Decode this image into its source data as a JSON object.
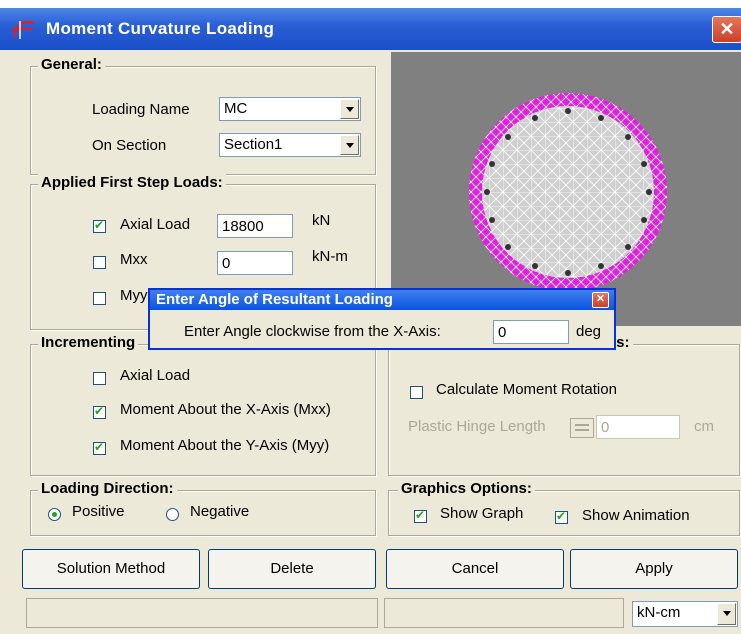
{
  "window": {
    "title": "Moment Curvature Loading",
    "close_glyph": "✕",
    "app_icon": "curvature-app-icon"
  },
  "general": {
    "title": "General:",
    "loading_name_label": "Loading Name",
    "loading_name_value": "MC",
    "on_section_label": "On Section",
    "on_section_value": "Section1"
  },
  "first_step": {
    "title": "Applied First Step Loads:",
    "axial_label": "Axial Load",
    "axial_checked": true,
    "axial_value": "18800",
    "axial_unit": "kN",
    "mxx_label": "Mxx",
    "mxx_checked": false,
    "mxx_value": "0",
    "mxx_unit": "kN-m",
    "myy_label": "Myy",
    "myy_checked": false
  },
  "incrementing": {
    "title": "Incrementing",
    "axial_label": "Axial Load",
    "axial_checked": false,
    "mxx_label": "Moment About the X-Axis (Mxx)",
    "mxx_checked": true,
    "myy_label": "Moment About the Y-Axis (Myy)",
    "myy_checked": true
  },
  "options": {
    "title_fragment": "ns:",
    "moment_rotation_label": "Calculate Moment Rotation",
    "moment_rotation_checked": false,
    "hinge_label": "Plastic Hinge Length",
    "hinge_value": "0",
    "hinge_unit": "cm"
  },
  "direction": {
    "title": "Loading Direction:",
    "positive_label": "Positive",
    "negative_label": "Negative",
    "selected": "Positive"
  },
  "graphics": {
    "title": "Graphics Options:",
    "graph_label": "Show Graph",
    "graph_checked": true,
    "animation_label": "Show Animation",
    "animation_checked": true
  },
  "buttons": {
    "solution": "Solution Method",
    "delete": "Delete",
    "cancel": "Cancel",
    "apply": "Apply"
  },
  "status": {
    "units_value": "kN-cm"
  },
  "popup": {
    "title": "Enter Angle of Resultant Loading",
    "prompt": "Enter Angle clockwise from the X-Axis:",
    "value": "0",
    "unit": "deg",
    "close_glyph": "✕"
  },
  "colors": {
    "cover_ring": "#e31de3",
    "core_mesh": "#c8c8c8",
    "preview_bg": "#808080",
    "titlebar": "#2a5fd6"
  }
}
